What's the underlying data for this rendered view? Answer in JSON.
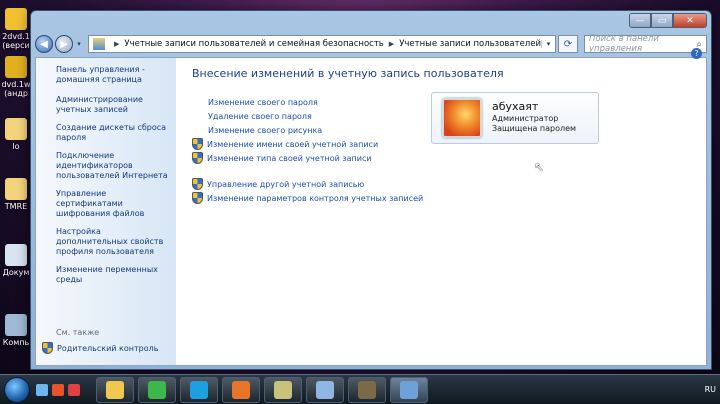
{
  "desktop": {
    "icons": [
      {
        "label": "2dvd.1",
        "sub": "(верси",
        "color": "#f0c030"
      },
      {
        "label": "dvd.1w",
        "sub": "(андр",
        "color": "#e0b020"
      },
      {
        "label": "lo",
        "sub": "",
        "color": "#f2d37a"
      },
      {
        "label": "TMRE",
        "sub": "",
        "color": "#f2d37a"
      },
      {
        "label": "Докум",
        "sub": "",
        "color": "#d8e4f0"
      },
      {
        "label": "Компь",
        "sub": "",
        "color": "#9fb8d4"
      }
    ]
  },
  "window": {
    "caption_min": "—",
    "caption_max": "▭",
    "caption_close": "✕",
    "nav": {
      "back": "◀",
      "forward": "▶",
      "dropdown": "▾"
    },
    "address": {
      "crumbs": [
        "Учетные записи пользователей и семейная безопасность",
        "Учетные записи пользователей"
      ],
      "separator": "▶",
      "dropdown": "▾"
    },
    "refresh": "⟳",
    "search_placeholder": "Поиск в панели управления",
    "search_icon": "⌕"
  },
  "sidebar": {
    "home": "Панель управления - домашняя страница",
    "items": [
      "Администрирование учетных записей",
      "Создание дискеты сброса пароля",
      "Подключение идентификаторов пользователей Интернета",
      "Управление сертификатами шифрования файлов",
      "Настройка дополнительных свойств профиля пользователя",
      "Изменение переменных среды"
    ],
    "see_also": "См. также",
    "parental": "Родительский контроль"
  },
  "main": {
    "title": "Внесение изменений в учетную запись пользователя",
    "links_group1": [
      {
        "text": "Изменение своего пароля",
        "shield": false
      },
      {
        "text": "Удаление своего пароля",
        "shield": false
      },
      {
        "text": "Изменение своего рисунка",
        "shield": false
      },
      {
        "text": "Изменение имени своей учетной записи",
        "shield": true
      },
      {
        "text": "Изменение типа своей учетной записи",
        "shield": true
      }
    ],
    "links_group2": [
      {
        "text": "Управление другой учетной записью",
        "shield": true
      },
      {
        "text": "Изменение параметров контроля учетных записей",
        "shield": true
      }
    ],
    "help": "?"
  },
  "user": {
    "name": "абухаят",
    "role": "Администратор",
    "status": "Защищена паролем"
  },
  "taskbar": {
    "quick_colors": [
      "#6db6f0",
      "#e8542a",
      "#e04040"
    ],
    "tasks": [
      {
        "name": "explorer",
        "color": "#f0c850",
        "active": false
      },
      {
        "name": "mail-agent",
        "color": "#3cb84a",
        "active": false
      },
      {
        "name": "skype",
        "color": "#1ea0e0",
        "active": false
      },
      {
        "name": "firefox",
        "color": "#e8762a",
        "active": false
      },
      {
        "name": "notes",
        "color": "#c9c27a",
        "active": false
      },
      {
        "name": "images",
        "color": "#8fb6e0",
        "active": false
      },
      {
        "name": "camera",
        "color": "#7a6a4a",
        "active": false
      },
      {
        "name": "control-panel",
        "color": "#6fa0d8",
        "active": true
      }
    ],
    "lang": "RU"
  }
}
